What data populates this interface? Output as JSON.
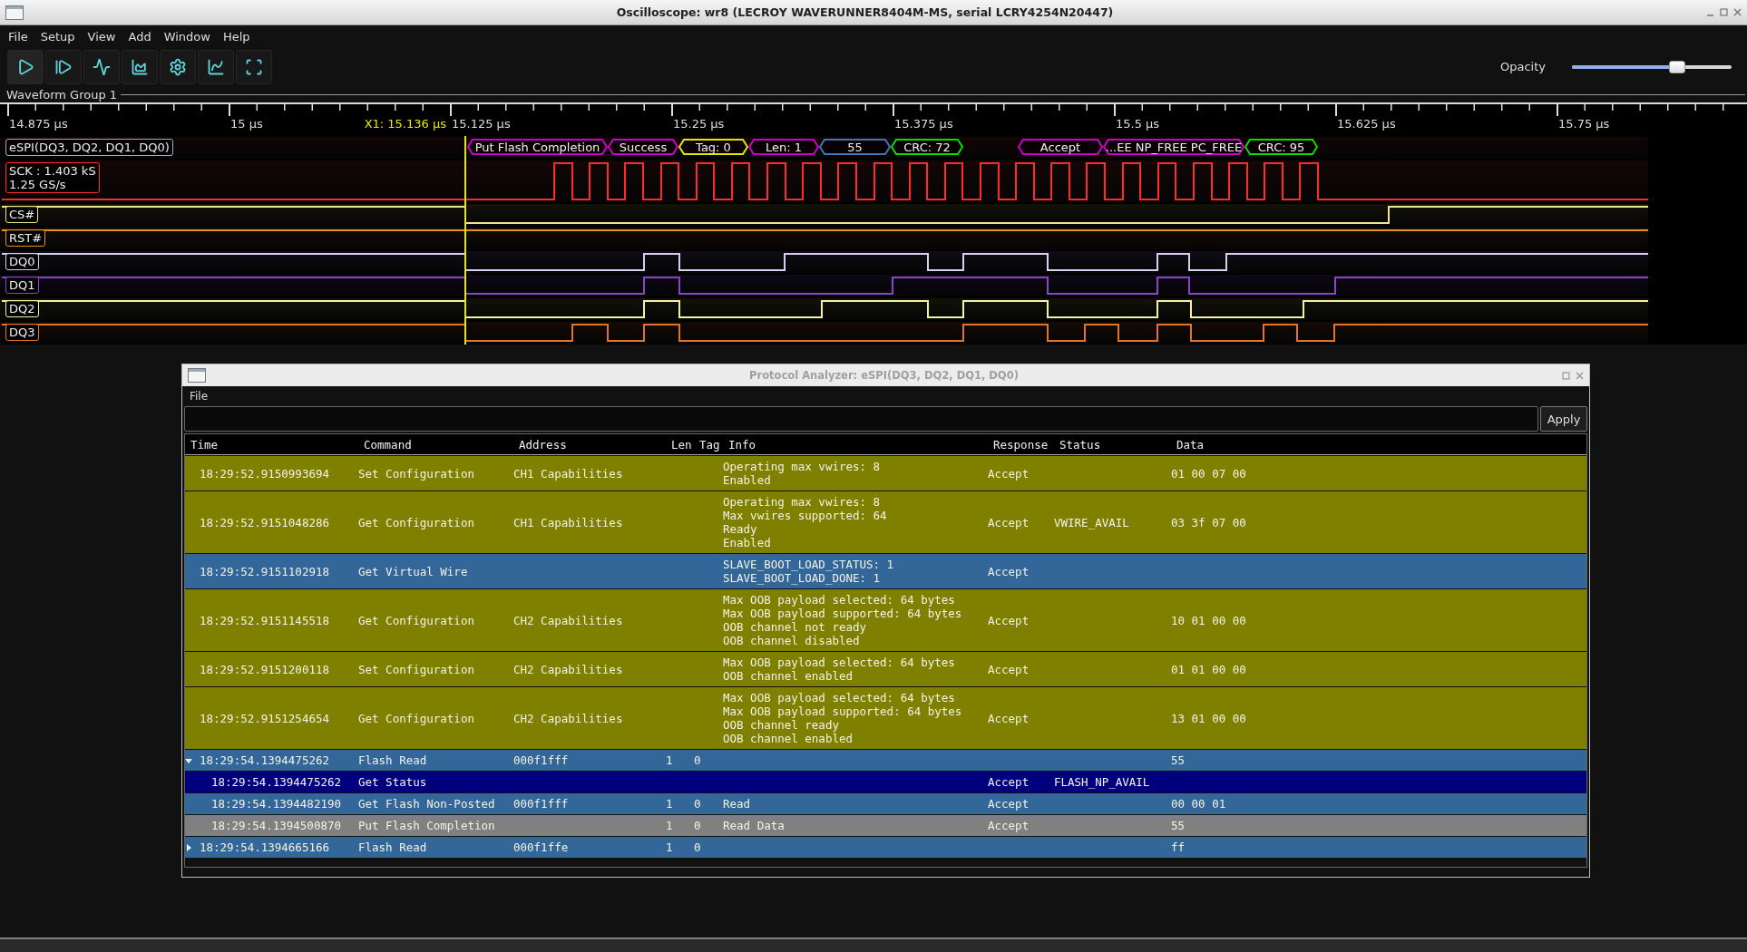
{
  "window": {
    "title": "Oscilloscope: wr8 (LECROY WAVERUNNER8404M-MS, serial LCRY4254N20447)"
  },
  "menu": [
    "File",
    "Setup",
    "View",
    "Add",
    "Window",
    "Help"
  ],
  "opacity": {
    "label": "Opacity",
    "level": 0.66
  },
  "waveform_group": {
    "title": "Waveform Group 1",
    "ticks": [
      "14.875 µs",
      "15 µs",
      "15.125 µs",
      "15.25 µs",
      "15.375 µs",
      "15.5 µs",
      "15.625 µs",
      "15.75 µs"
    ],
    "cursor": {
      "label": "X1: 15.136 µs"
    },
    "decode": {
      "label": "eSPI(DQ3, DQ2, DQ1, DQ0)",
      "packets": [
        {
          "text": "Put Flash Completion",
          "color": "#cc00cc"
        },
        {
          "text": "Success",
          "color": "#cc00cc"
        },
        {
          "text": "Tag: 0",
          "color": "#e6e600"
        },
        {
          "text": "Len: 1",
          "color": "#cc00cc"
        },
        {
          "text": "55",
          "color": "#3a78b8"
        },
        {
          "text": "CRC: 72",
          "color": "#00e000"
        },
        {
          "text": "Accept",
          "color": "#cc00cc"
        },
        {
          "text": "...EE NP_FREE PC_FREE",
          "color": "#cc00cc"
        },
        {
          "text": "CRC: 95",
          "color": "#00e000"
        }
      ]
    },
    "channels": [
      {
        "label": "SCK : 1.403 kS",
        "sublabel": "1.25 GS/s",
        "color": "#ff2a2a"
      },
      {
        "label": "CS#",
        "color": "#f0e68c"
      },
      {
        "label": "RST#",
        "color": "#e8901c"
      },
      {
        "label": "DQ0",
        "color": "#d8d0f0"
      },
      {
        "label": "DQ1",
        "color": "#8a44c8"
      },
      {
        "label": "DQ2",
        "color": "#f2f2a0"
      },
      {
        "label": "DQ3",
        "color": "#e07428"
      }
    ]
  },
  "analyzer": {
    "title": "Protocol Analyzer: eSPI(DQ3, DQ2, DQ1, DQ0)",
    "menu": [
      "File"
    ],
    "apply": "Apply",
    "columns": [
      "Time",
      "Command",
      "Address",
      "Len",
      "Tag",
      "Info",
      "Response",
      "Status",
      "Data"
    ],
    "rows": [
      {
        "time": "18:29:52.9150993694",
        "command": "Set Configuration",
        "address": "CH1 Capabilities",
        "len": "",
        "tag": "",
        "info": [
          "Operating max vwires: 8",
          "Enabled"
        ],
        "response": "Accept",
        "status": "",
        "data": "01 00 07 00",
        "color": "#808000",
        "selected": false
      },
      {
        "time": "18:29:52.9151048286",
        "command": "Get Configuration",
        "address": "CH1 Capabilities",
        "len": "",
        "tag": "",
        "info": [
          "Operating max vwires: 8",
          "Max vwires supported: 64",
          "Ready",
          "Enabled"
        ],
        "response": "Accept",
        "status": "VWIRE_AVAIL",
        "data": "03 3f 07 00",
        "color": "#808000",
        "selected": false
      },
      {
        "time": "18:29:52.9151102918",
        "command": "Get Virtual Wire",
        "address": "",
        "len": "",
        "tag": "",
        "info": [
          "SLAVE_BOOT_LOAD_STATUS: 1",
          "SLAVE_BOOT_LOAD_DONE: 1"
        ],
        "response": "Accept",
        "status": "",
        "data": "",
        "color": "#336699",
        "selected": false
      },
      {
        "time": "18:29:52.9151145518",
        "command": "Get Configuration",
        "address": "CH2 Capabilities",
        "len": "",
        "tag": "",
        "info": [
          "Max OOB payload selected: 64 bytes",
          "Max OOB payload supported: 64 bytes",
          "OOB channel not ready",
          "OOB channel disabled"
        ],
        "response": "Accept",
        "status": "",
        "data": "10 01 00 00",
        "color": "#808000",
        "selected": false
      },
      {
        "time": "18:29:52.9151200118",
        "command": "Set Configuration",
        "address": "CH2 Capabilities",
        "len": "",
        "tag": "",
        "info": [
          "Max OOB payload selected: 64 bytes",
          "OOB channel enabled"
        ],
        "response": "Accept",
        "status": "",
        "data": "01 01 00 00",
        "color": "#808000",
        "selected": false
      },
      {
        "time": "18:29:52.9151254654",
        "command": "Get Configuration",
        "address": "CH2 Capabilities",
        "len": "",
        "tag": "",
        "info": [
          "Max OOB payload selected: 64 bytes",
          "Max OOB payload supported: 64 bytes",
          "OOB channel ready",
          "OOB channel enabled"
        ],
        "response": "Accept",
        "status": "",
        "data": "13 01 00 00",
        "color": "#808000",
        "selected": false
      },
      {
        "time": "18:29:54.1394475262",
        "command": "Flash Read",
        "address": "000f1fff",
        "len": "1",
        "tag": "0",
        "info": [],
        "response": "",
        "status": "",
        "data": "55",
        "color": "#336699",
        "selected": false,
        "expanded": true,
        "children": [
          {
            "time": "18:29:54.1394475262",
            "command": "Get Status",
            "response": "Accept",
            "status": "FLASH_NP_AVAIL",
            "selected": true
          },
          {
            "time": "18:29:54.1394482190",
            "command": "Get Flash Non-Posted",
            "address": "000f1fff",
            "len": "1",
            "tag": "0",
            "info": [
              "Read"
            ],
            "response": "Accept",
            "data": "00 00 01",
            "color": "#336699",
            "selected": false
          },
          {
            "time": "18:29:54.1394500870",
            "command": "Put Flash Completion",
            "len": "1",
            "tag": "0",
            "info": [
              "Read Data"
            ],
            "response": "Accept",
            "data": "55",
            "color": "#808080",
            "selected": false
          }
        ]
      },
      {
        "time": "18:29:54.1394665166",
        "command": "Flash Read",
        "address": "000f1ffe",
        "len": "1",
        "tag": "0",
        "info": [],
        "response": "",
        "status": "",
        "data": "ff",
        "color": "#336699",
        "selected": false,
        "expanded": false,
        "children": []
      }
    ]
  }
}
